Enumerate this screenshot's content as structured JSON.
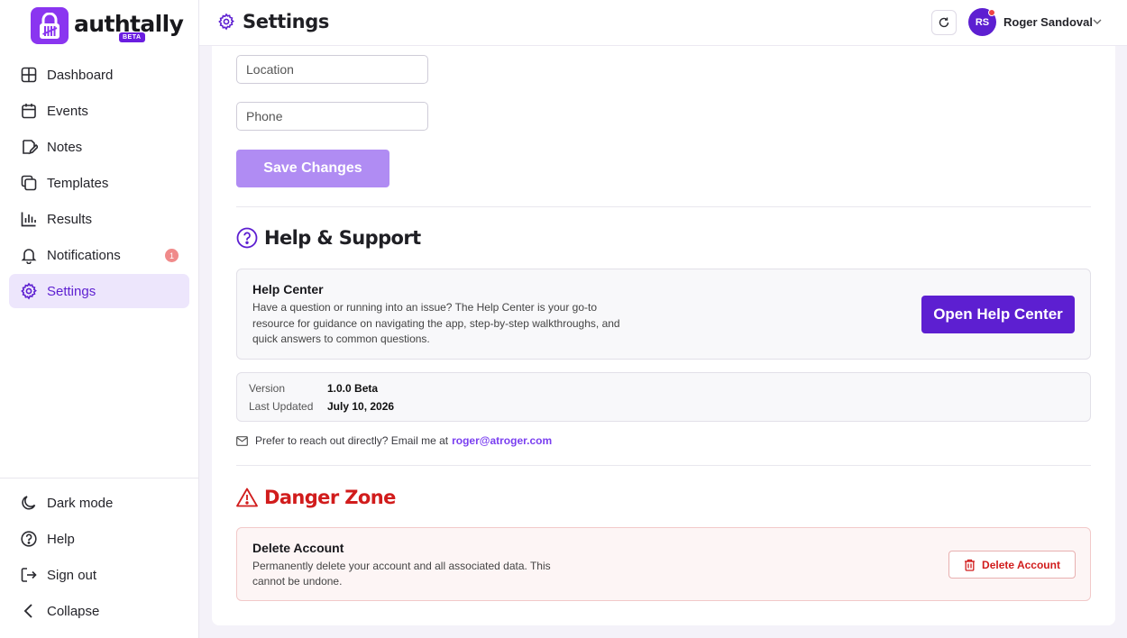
{
  "brand": {
    "name": "authtally",
    "badge": "BETA"
  },
  "nav": {
    "items": [
      {
        "label": "Dashboard",
        "icon": "dashboard-icon"
      },
      {
        "label": "Events",
        "icon": "calendar-icon"
      },
      {
        "label": "Notes",
        "icon": "notes-icon"
      },
      {
        "label": "Templates",
        "icon": "templates-icon"
      },
      {
        "label": "Results",
        "icon": "bar-chart-icon"
      },
      {
        "label": "Notifications",
        "icon": "bell-icon",
        "badge": "1"
      },
      {
        "label": "Settings",
        "icon": "gear-icon",
        "active": true
      }
    ],
    "bottom": [
      {
        "label": "Dark mode",
        "icon": "moon-icon"
      },
      {
        "label": "Help",
        "icon": "help-circle-icon"
      },
      {
        "label": "Sign out",
        "icon": "sign-out-icon"
      },
      {
        "label": "Collapse",
        "icon": "chevron-left-icon"
      }
    ]
  },
  "header": {
    "title": "Settings",
    "user": {
      "initials": "RS",
      "name": "Roger Sandoval"
    }
  },
  "profile": {
    "location_placeholder": "Location",
    "phone_placeholder": "Phone",
    "save_label": "Save Changes"
  },
  "help": {
    "title": "Help & Support",
    "center_title": "Help Center",
    "center_desc": "Have a question or running into an issue? The Help Center is your go-to resource for guidance on navigating the app, step-by-step walkthroughs, and quick answers to common questions.",
    "open_label": "Open Help Center",
    "version_label": "Version",
    "version_value": "1.0.0 Beta",
    "updated_label": "Last Updated",
    "updated_value": "July 10, 2026",
    "contact_text": "Prefer to reach out directly? Email me at",
    "contact_email": "roger@atroger.com"
  },
  "danger": {
    "title": "Danger Zone",
    "delete_title": "Delete Account",
    "delete_desc": "Permanently delete your account and all associated data. This cannot be undone.",
    "delete_label": "Delete Account"
  },
  "colors": {
    "accent": "#5d1fd1",
    "accent_light": "#b08cf3",
    "danger": "#d11c1c"
  }
}
